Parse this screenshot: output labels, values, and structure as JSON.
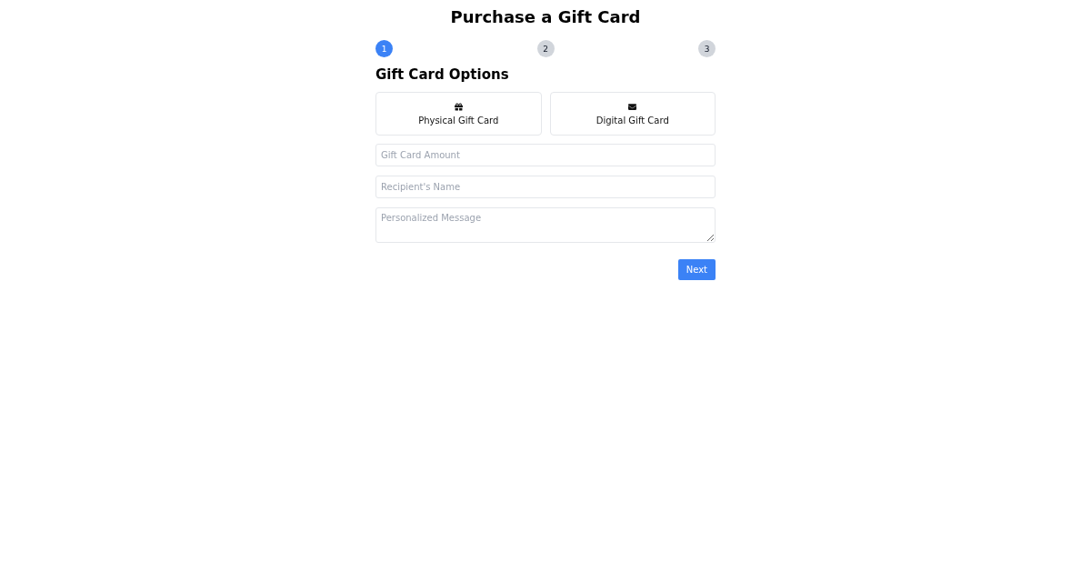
{
  "page": {
    "title": "Purchase a Gift Card"
  },
  "steps": [
    {
      "label": "1",
      "selected": true
    },
    {
      "label": "2",
      "selected": false
    },
    {
      "label": "3",
      "selected": false
    }
  ],
  "section": {
    "heading": "Gift Card Options"
  },
  "options": [
    {
      "kind": "gift",
      "label": "Physical Gift Card",
      "selected": false
    },
    {
      "kind": "envelope",
      "label": "Digital Gift Card",
      "selected": false
    }
  ],
  "fields": [
    {
      "kind": "input",
      "placeholder": "Gift Card Amount"
    },
    {
      "kind": "input",
      "placeholder": "Recipient's Name"
    },
    {
      "kind": "textarea",
      "placeholder": "Personalized Message"
    }
  ],
  "buttons": [
    {
      "label": "Next"
    }
  ]
}
